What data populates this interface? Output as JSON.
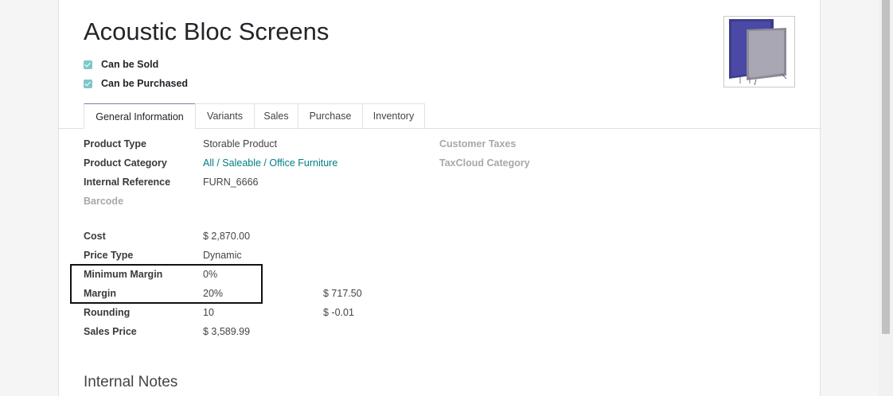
{
  "product": {
    "name": "Acoustic Bloc Screens",
    "can_be_sold_label": "Can be Sold",
    "can_be_purchased_label": "Can be Purchased"
  },
  "tabs": [
    {
      "label": "General Information",
      "active": true
    },
    {
      "label": "Variants"
    },
    {
      "label": "Sales"
    },
    {
      "label": "Purchase"
    },
    {
      "label": "Inventory"
    }
  ],
  "fields": {
    "product_type": {
      "label": "Product Type",
      "value": "Storable Product"
    },
    "product_category": {
      "label": "Product Category",
      "value": "All / Saleable / Office Furniture"
    },
    "internal_reference": {
      "label": "Internal Reference",
      "value": "FURN_6666"
    },
    "barcode": {
      "label": "Barcode"
    },
    "cost": {
      "label": "Cost",
      "value": "$ 2,870.00"
    },
    "price_type": {
      "label": "Price Type",
      "value": "Dynamic"
    },
    "minimum_margin": {
      "label": "Minimum Margin",
      "value": "0%"
    },
    "margin": {
      "label": "Margin",
      "value": "20%",
      "amount": "$ 717.50"
    },
    "rounding": {
      "label": "Rounding",
      "value": "10",
      "amount": "$ -0.01"
    },
    "sales_price": {
      "label": "Sales Price",
      "value": "$ 3,589.99"
    },
    "customer_taxes": {
      "label": "Customer Taxes"
    },
    "taxcloud_category": {
      "label": "TaxCloud Category"
    }
  },
  "internal_notes_title": "Internal Notes",
  "colors": {
    "accent": "#017e84",
    "checkbox": "#7ec7cb",
    "tab_active_border": "#7c7bad"
  }
}
